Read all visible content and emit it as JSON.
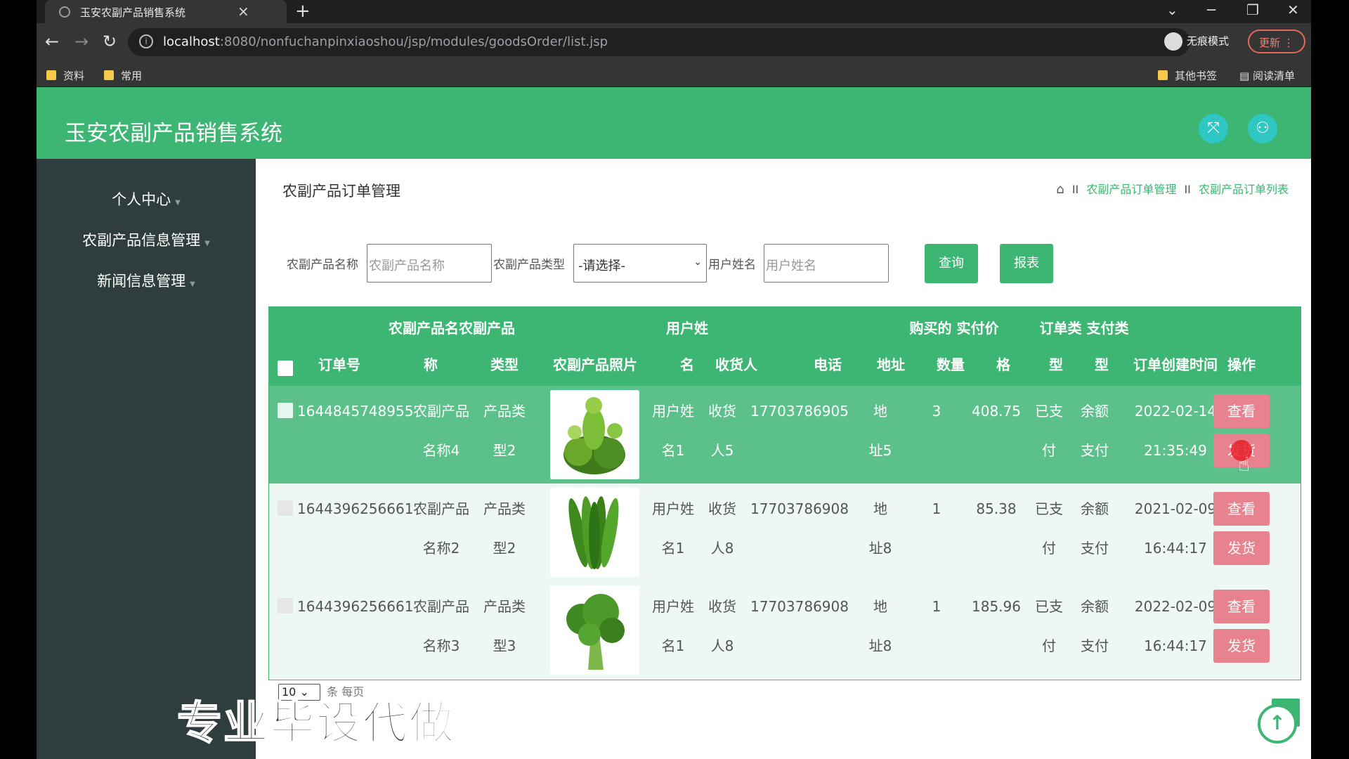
{
  "browser": {
    "tab_title": "玉安农副产品销售系统",
    "tab_close": "×",
    "new_tab": "+",
    "url_host": "localhost",
    "url_rest": ":8080/nonfuchanpinxiaoshou/jsp/modules/goodsOrder/list.jsp",
    "incognito_label": "无痕模式",
    "update_label": "更新",
    "bookmarks": [
      "资料",
      "常用"
    ],
    "other_bookmarks": "其他书签",
    "reading_list": "阅读清单"
  },
  "app": {
    "title": "玉安农副产品销售系统"
  },
  "sidebar": {
    "items": [
      {
        "label": "个人中心"
      },
      {
        "label": "农副产品信息管理"
      },
      {
        "label": "新闻信息管理"
      }
    ]
  },
  "page": {
    "title": "农副产品订单管理",
    "breadcrumb": [
      "农副产品订单管理",
      "农副产品订单列表"
    ],
    "breadcrumb_sep": "II"
  },
  "filters": {
    "name_label": "农副产品名称",
    "name_placeholder": "农副产品名称",
    "type_label": "农副产品类型",
    "type_selected": "-请选择-",
    "user_label": "用户姓名",
    "user_placeholder": "用户姓名",
    "query_button": "查询",
    "report_button": "报表"
  },
  "table": {
    "headers": {
      "order_no": "订单号",
      "name_l1": "农副产品名",
      "name_l2": "称",
      "type_l1": "农副产品",
      "type_l2": "类型",
      "photo": "农副产品照片",
      "user_l1": "用户姓",
      "user_l2": "名",
      "receiver": "收货人",
      "phone": "电话",
      "address": "地址",
      "qty_l1": "购买的",
      "qty_l2": "数量",
      "price_l1": "实付价",
      "price_l2": "格",
      "otype_l1": "订单类",
      "otype_l2": "型",
      "ptype_l1": "支付类",
      "ptype_l2": "型",
      "created": "订单创建时间",
      "actions": "操作"
    },
    "rows": [
      {
        "order_no": "1644845748955",
        "name_1": "农副产品",
        "name_2": "名称4",
        "type_1": "产品类",
        "type_2": "型2",
        "user_1": "用户姓",
        "user_2": "名1",
        "receiver_1": "收货",
        "receiver_2": "人5",
        "phone": "17703786905",
        "address_1": "地",
        "address_2": "址5",
        "qty": "3",
        "price": "408.75",
        "otype_1": "已支",
        "otype_2": "付",
        "ptype_1": "余额",
        "ptype_2": "支付",
        "date": "2022-02-14",
        "time": "21:35:49",
        "view_button": "查看",
        "ship_button": "发货"
      },
      {
        "order_no": "1644396256661",
        "name_1": "农副产品",
        "name_2": "名称2",
        "type_1": "产品类",
        "type_2": "型2",
        "user_1": "用户姓",
        "user_2": "名1",
        "receiver_1": "收货",
        "receiver_2": "人8",
        "phone": "17703786908",
        "address_1": "地",
        "address_2": "址8",
        "qty": "1",
        "price": "85.38",
        "otype_1": "已支",
        "otype_2": "付",
        "ptype_1": "余额",
        "ptype_2": "支付",
        "date": "2021-02-09",
        "time": "16:44:17",
        "view_button": "查看",
        "ship_button": "发货"
      },
      {
        "order_no": "1644396256661",
        "name_1": "农副产品",
        "name_2": "名称3",
        "type_1": "产品类",
        "type_2": "型3",
        "user_1": "用户姓",
        "user_2": "名1",
        "receiver_1": "收货",
        "receiver_2": "人8",
        "phone": "17703786908",
        "address_1": "地",
        "address_2": "址8",
        "qty": "1",
        "price": "185.96",
        "otype_1": "已支",
        "otype_2": "付",
        "ptype_1": "余额",
        "ptype_2": "支付",
        "date": "2022-02-09",
        "time": "16:44:17",
        "view_button": "查看",
        "ship_button": "发货"
      }
    ]
  },
  "pager": {
    "page_size": "10",
    "per_page_label": "条 每页"
  },
  "watermark": "专业毕设代做",
  "colors": {
    "brand_green": "#3db573",
    "row_highlight": "#5cc08a",
    "action_pink": "#e8828e",
    "sidebar_bg": "#2f3d3e"
  }
}
